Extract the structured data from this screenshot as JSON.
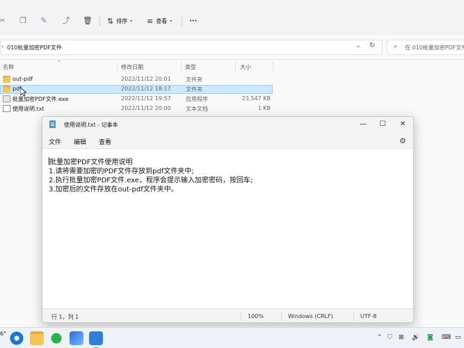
{
  "explorer": {
    "toolbar": {
      "sort_label": "排序",
      "view_label": "查看",
      "more_label": "···"
    },
    "address": {
      "path": "010批量加密PDF文件",
      "search_placeholder": "在 010批量加密PDF文件"
    },
    "columns": {
      "name": "名称",
      "date": "修改日期",
      "type": "类型",
      "size": "大小"
    },
    "files": [
      {
        "name": "out-pdf",
        "date": "2022/11/12 20:01",
        "type": "文件夹",
        "size": "",
        "kind": "folder"
      },
      {
        "name": "pdf",
        "date": "2022/11/12 18:17",
        "type": "文件夹",
        "size": "",
        "kind": "folder",
        "selected": true
      },
      {
        "name": "批量加密PDF文件.exe",
        "date": "2022/11/12 19:57",
        "type": "应用程序",
        "size": "23,547 KB",
        "kind": "exe"
      },
      {
        "name": "使用说明.txt",
        "date": "2022/11/12 20:00",
        "type": "文本文档",
        "size": "1 KB",
        "kind": "txt"
      }
    ]
  },
  "notepad": {
    "title": "使用说明.txt - 记事本",
    "menu": {
      "file": "文件",
      "edit": "编辑",
      "view": "查看"
    },
    "lines": [
      "批量加密PDF文件使用说明",
      "1.请将需要加密的PDF文件存放到pdf文件夹中;",
      "2.执行批量加密PDF文件.exe，程序会提示输入加密密码，按回车;",
      "3.加密后的文件存放在out-pdf文件夹中。"
    ],
    "status": {
      "position": "行 1，列 1",
      "zoom": "100%",
      "line_ending": "Windows (CRLF)",
      "encoding": "UTF-8"
    }
  },
  "taskbar": {
    "weather": "6°"
  }
}
